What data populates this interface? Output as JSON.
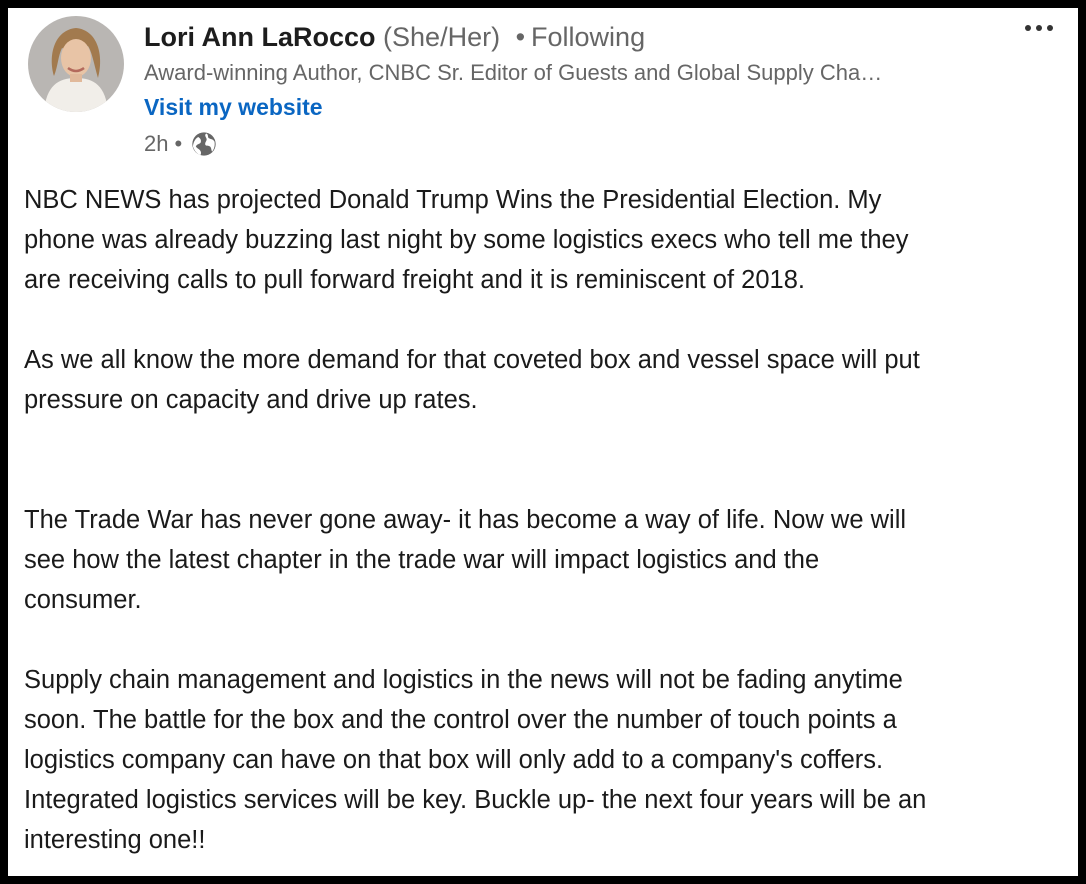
{
  "post": {
    "author": {
      "name": "Lori Ann LaRocco",
      "pronouns": "(She/Her)",
      "separator": "•",
      "follow_status": "Following",
      "headline": "Award-winning Author, CNBC Sr. Editor of Guests and Global Supply Cha…",
      "website_link": "Visit my website"
    },
    "meta": {
      "time": "2h",
      "separator": "•",
      "visibility_icon": "globe-icon"
    },
    "menu_icon": "more-horizontal-icon",
    "body": {
      "paragraph_1": "NBC NEWS has projected Donald Trump Wins the Presidential Election. My\nphone was already buzzing last night by some logistics execs who tell me they\nare receiving calls to pull forward freight and it is reminiscent of 2018.",
      "paragraph_2": "As we all know the more demand for that coveted box and vessel space will put\npressure on capacity and drive up rates.",
      "paragraph_3": "The Trade War has never gone away- it has become a way of life. Now we will\nsee how the latest chapter in the trade war will impact logistics and the\nconsumer.",
      "paragraph_4": "Supply chain management and logistics in the news will not be fading anytime\nsoon. The battle for the box and the control over the number of touch points a\nlogistics company can have on that box will only add to a company's coffers.\nIntegrated logistics services will be key. Buckle up- the next four years will be an\ninteresting one!!"
    }
  },
  "colors": {
    "link": "#0a66c2",
    "secondary_text": "#666666",
    "primary_text": "#1a1a1a",
    "frame": "#000000"
  }
}
